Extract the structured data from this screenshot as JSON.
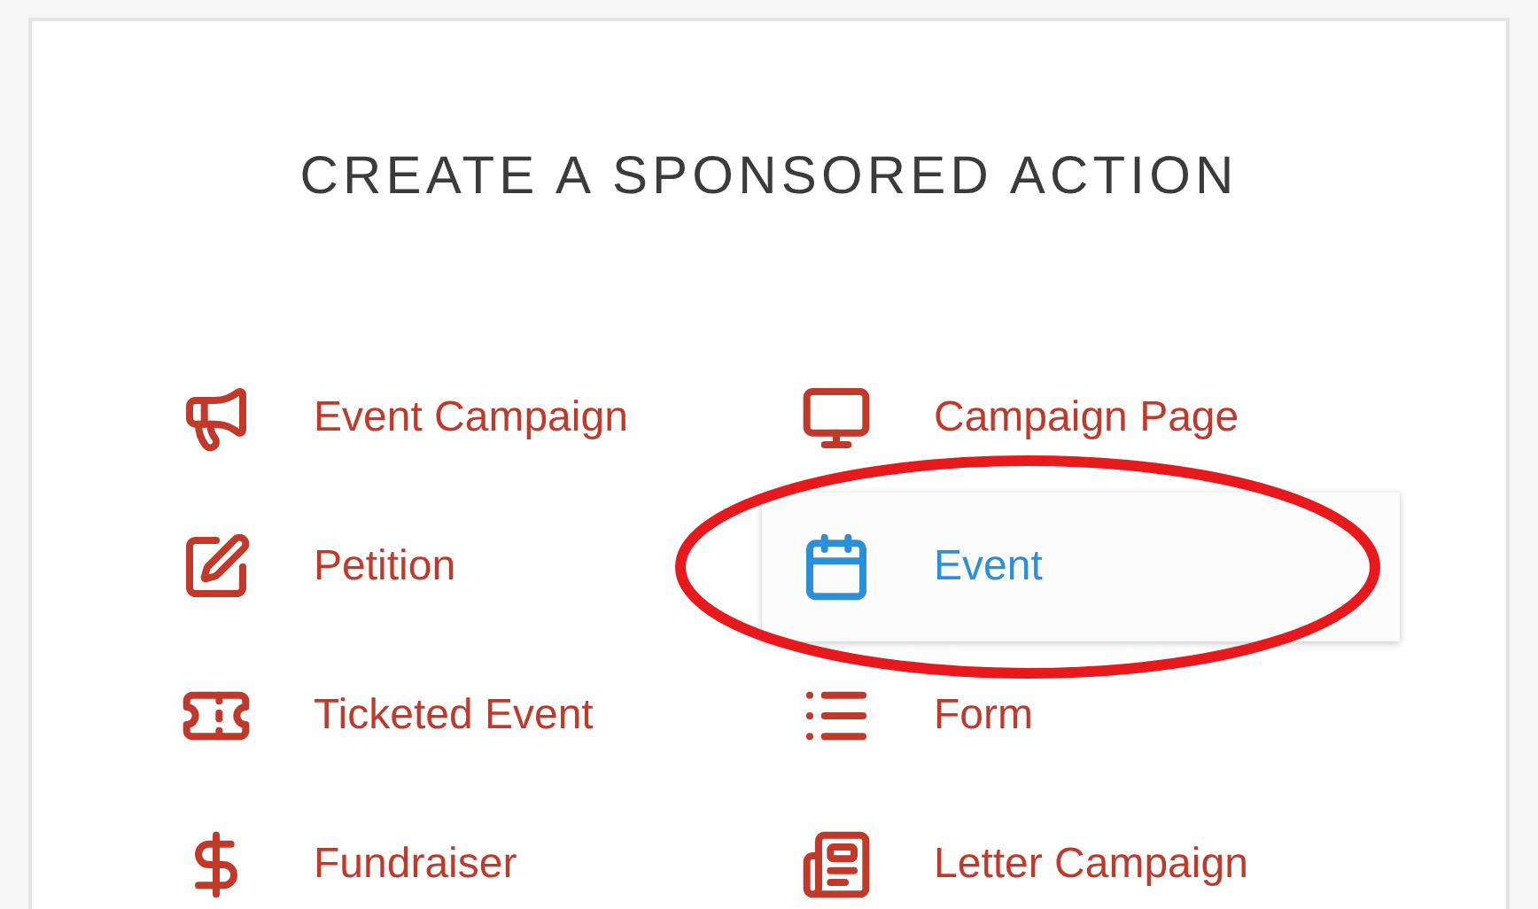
{
  "title": "CREATE A SPONSORED ACTION",
  "actions": [
    {
      "label": "Event Campaign",
      "kind": "megaphone",
      "selected": false,
      "circled": false
    },
    {
      "label": "Campaign Page",
      "kind": "monitor",
      "selected": false,
      "circled": false
    },
    {
      "label": "Petition",
      "kind": "pencil",
      "selected": false,
      "circled": false
    },
    {
      "label": "Event",
      "kind": "calendar",
      "selected": true,
      "circled": true
    },
    {
      "label": "Ticketed Event",
      "kind": "ticket",
      "selected": false,
      "circled": false
    },
    {
      "label": "Form",
      "kind": "list",
      "selected": false,
      "circled": false
    },
    {
      "label": "Fundraiser",
      "kind": "dollar",
      "selected": false,
      "circled": false
    },
    {
      "label": "Letter Campaign",
      "kind": "newspaper",
      "selected": false,
      "circled": false
    }
  ]
}
